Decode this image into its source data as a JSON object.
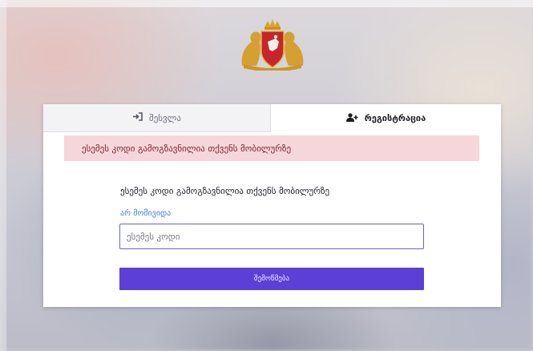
{
  "header": {
    "emblem": "georgia-coat-of-arms",
    "org_lines": []
  },
  "tabs": {
    "login": {
      "label": "შესვლა",
      "icon": "sign-in-icon"
    },
    "register": {
      "label": "რეგისტრაცია",
      "icon": "user-plus-icon"
    }
  },
  "alert": {
    "text": "ესემეს კოდი გამოგზავნილია თქვენს მობილურზე"
  },
  "form": {
    "instruction": "ესემეს კოდი გამოგზავნილია თქვენს მობილურზე",
    "resend_link": "არ მომივიდა",
    "code_input": {
      "placeholder": "ესემეს კოდი",
      "value": ""
    },
    "submit_label": "შემოწმება"
  },
  "colors": {
    "accent": "#5c3fd6",
    "alert_bg": "#f6d6da",
    "link": "#3f7fd6"
  }
}
